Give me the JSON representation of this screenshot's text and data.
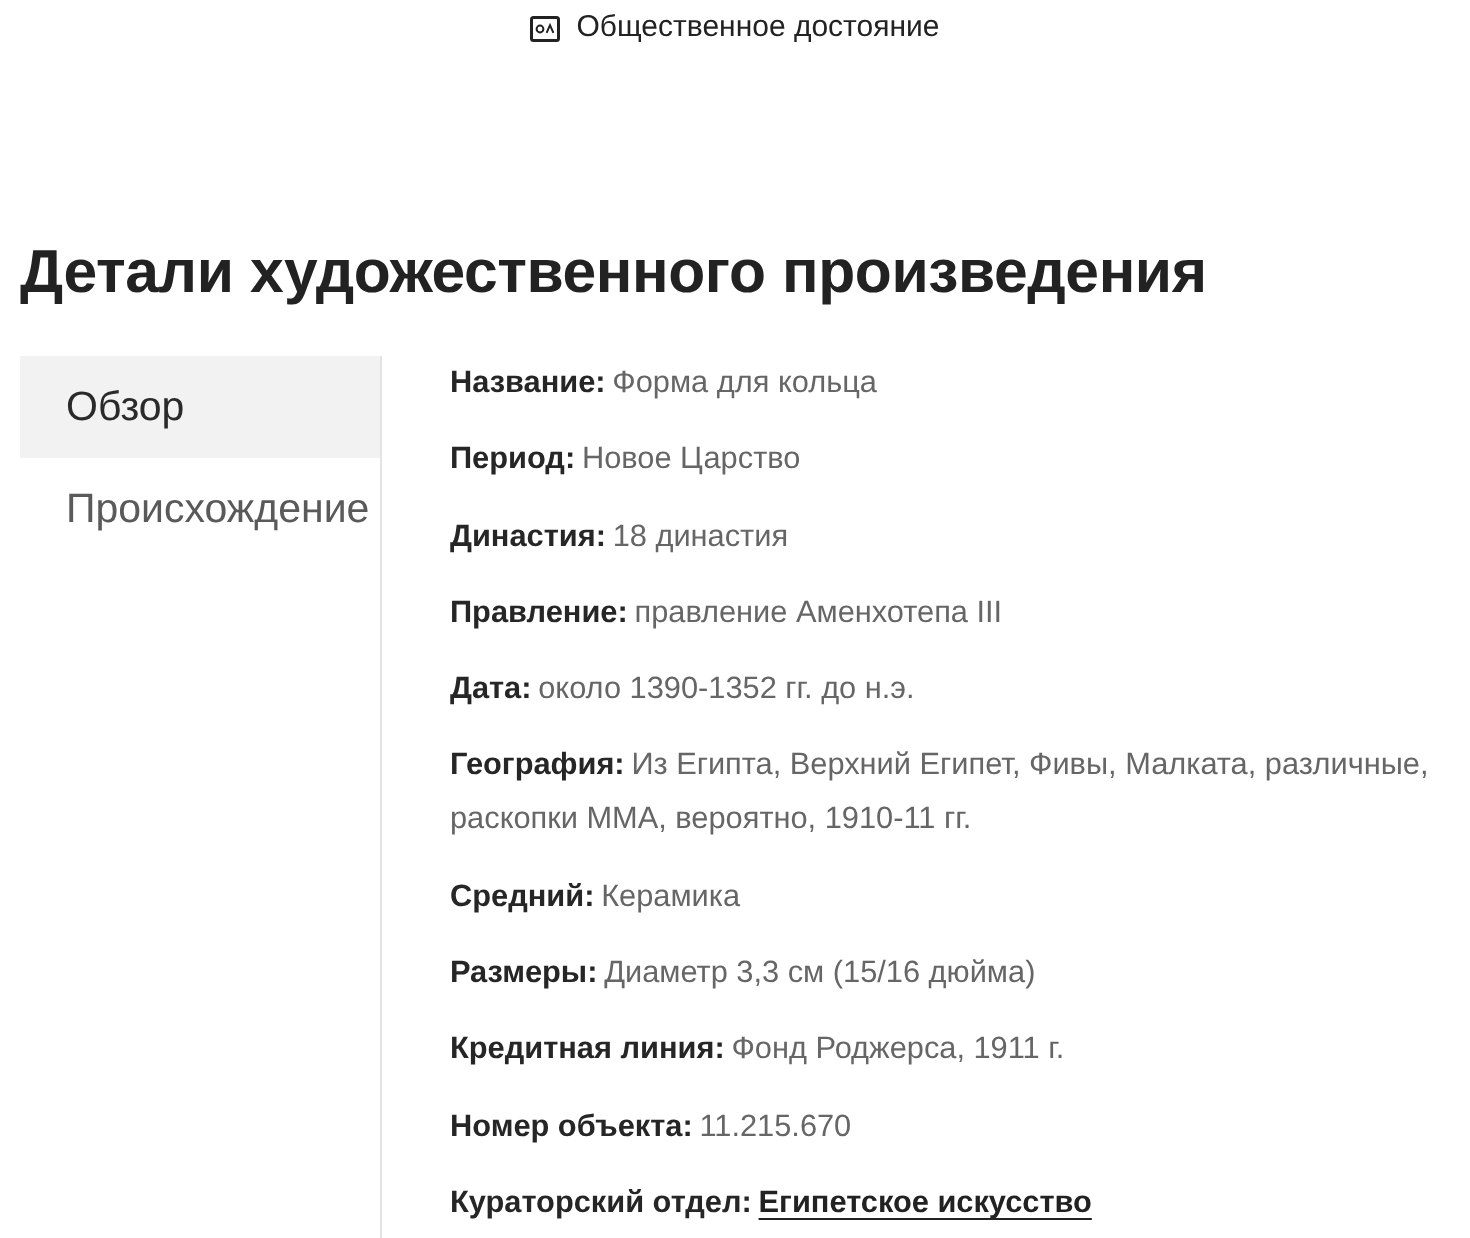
{
  "license": {
    "text": "Общественное достояние"
  },
  "title": "Детали художественного произведения",
  "tabs": [
    {
      "label": "Обзор",
      "selected": true
    },
    {
      "label": "Происхождение",
      "selected": false
    }
  ],
  "details": [
    {
      "kind": "text",
      "label": "Название:",
      "value": "Форма для кольца"
    },
    {
      "kind": "text",
      "label": "Период:",
      "value": "Новое Царство"
    },
    {
      "kind": "text",
      "label": "Династия:",
      "value": "18 династия"
    },
    {
      "kind": "text",
      "label": "Правление:",
      "value": "правление Аменхотепа III"
    },
    {
      "kind": "text",
      "label": "Дата:",
      "value": "около 1390-1352 гг. до н.э."
    },
    {
      "kind": "text",
      "label": "География:",
      "value": "Из Египта, Верхний Египет, Фивы, Малката, различные, раскопки MMA, вероятно, 1910-11 гг."
    },
    {
      "kind": "text",
      "label": "Средний:",
      "value": "Керамика"
    },
    {
      "kind": "text",
      "label": "Размеры:",
      "value": "Диаметр 3,3 см (15/16 дюйма)"
    },
    {
      "kind": "text",
      "label": "Кредитная линия:",
      "value": "Фонд Роджерса, 1911 г."
    },
    {
      "kind": "text",
      "label": "Номер объекта:",
      "value": "11.215.670"
    },
    {
      "kind": "link",
      "label": "Кураторский отдел:",
      "value": "Египетское искусство"
    }
  ]
}
